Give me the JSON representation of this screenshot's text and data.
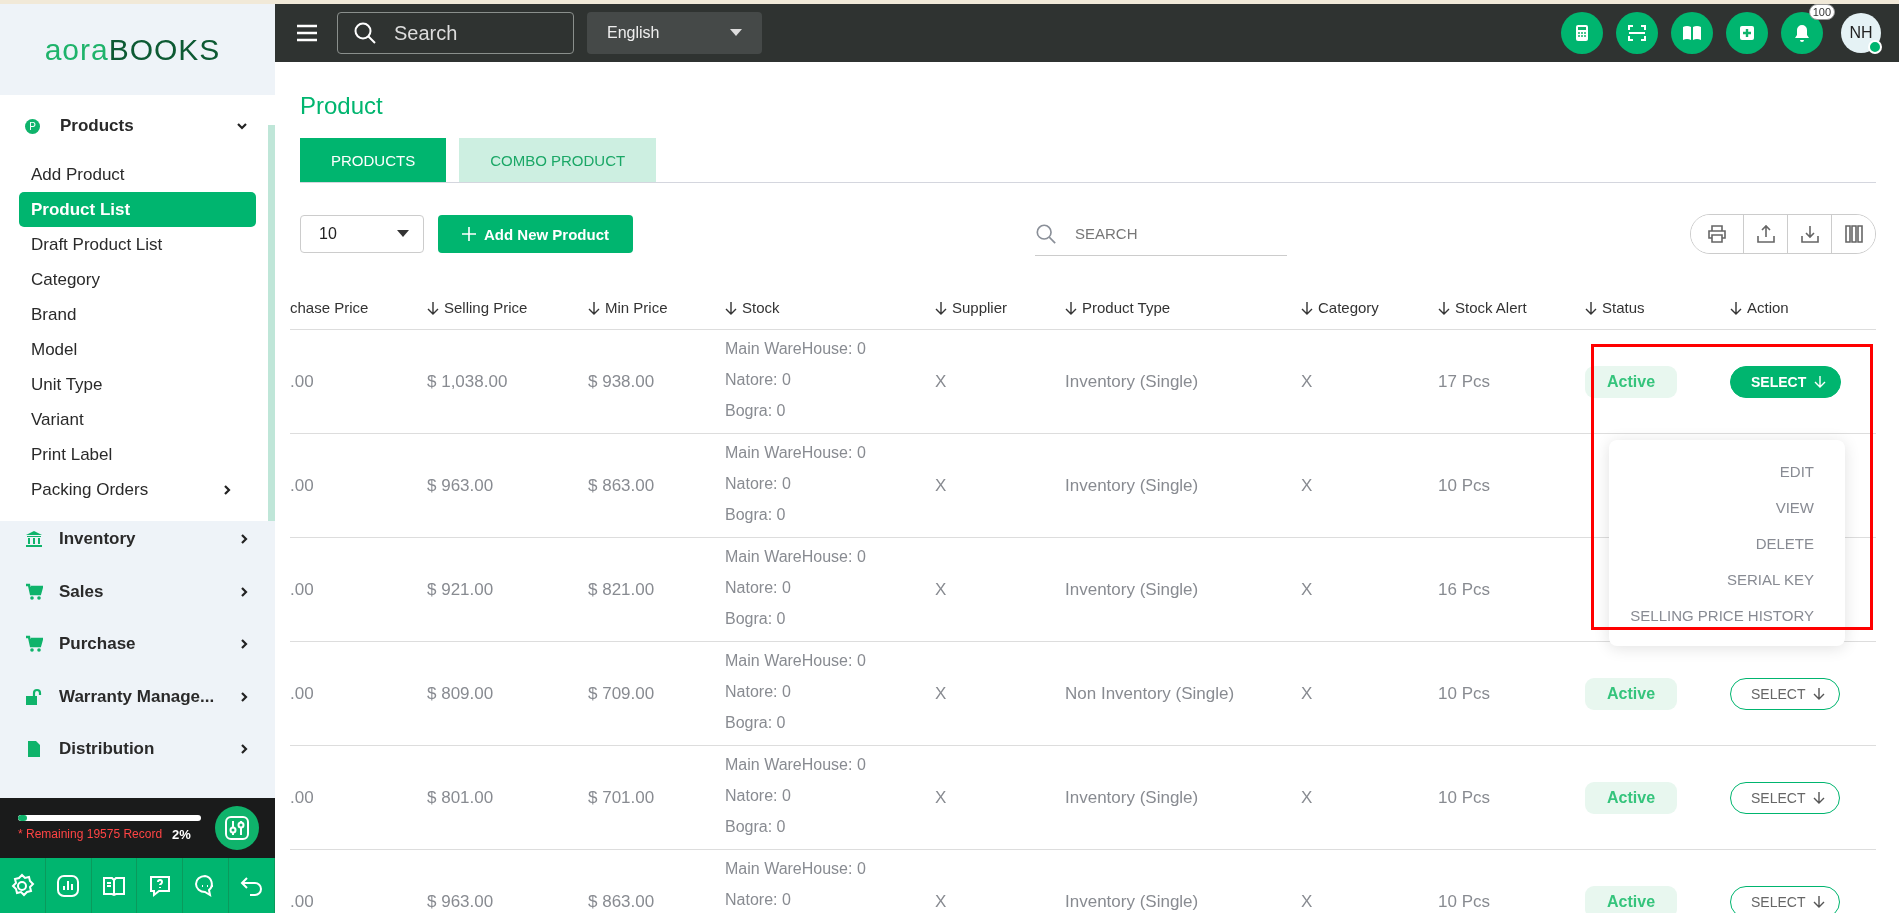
{
  "logo": {
    "light": "aora",
    "bold": "BOOKS"
  },
  "sidebar": {
    "section": {
      "badge": "P",
      "label": "Products",
      "expanded": true
    },
    "items": [
      {
        "label": "Add Product",
        "selected": false,
        "has_submenu": false
      },
      {
        "label": "Product List",
        "selected": true,
        "has_submenu": false
      },
      {
        "label": "Draft Product List",
        "selected": false,
        "has_submenu": false
      },
      {
        "label": "Category",
        "selected": false,
        "has_submenu": false
      },
      {
        "label": "Brand",
        "selected": false,
        "has_submenu": false
      },
      {
        "label": "Model",
        "selected": false,
        "has_submenu": false
      },
      {
        "label": "Unit Type",
        "selected": false,
        "has_submenu": false
      },
      {
        "label": "Variant",
        "selected": false,
        "has_submenu": false
      },
      {
        "label": "Print Label",
        "selected": false,
        "has_submenu": false
      },
      {
        "label": "Packing Orders",
        "selected": false,
        "has_submenu": true
      }
    ],
    "sections": [
      {
        "label": "Inventory"
      },
      {
        "label": "Sales"
      },
      {
        "label": "Purchase"
      },
      {
        "label": "Warranty Manage..."
      },
      {
        "label": "Distribution"
      }
    ]
  },
  "record_panel": {
    "level": 0.02,
    "text": "* Remaining 19575 Record",
    "percent": "2%"
  },
  "topbar": {
    "search_placeholder": "Search",
    "language": "English",
    "notification_count": "100",
    "avatar": "NH",
    "online": true
  },
  "page_title": "Product",
  "tabs": [
    {
      "label": "PRODUCTS",
      "selected": true
    },
    {
      "label": "COMBO PRODUCT",
      "selected": false
    }
  ],
  "toolbar": {
    "page_size": "10",
    "add_button": "Add New Product",
    "search_placeholder": "SEARCH"
  },
  "table": {
    "columns": [
      {
        "label": "chase Price",
        "sortable": false
      },
      {
        "label": "Selling Price",
        "sortable": true
      },
      {
        "label": "Min Price",
        "sortable": true
      },
      {
        "label": "Stock",
        "sortable": true
      },
      {
        "label": "Supplier",
        "sortable": true
      },
      {
        "label": "Product Type",
        "sortable": true
      },
      {
        "label": "Category",
        "sortable": true
      },
      {
        "label": "Stock Alert",
        "sortable": true
      },
      {
        "label": "Status",
        "sortable": true
      },
      {
        "label": "Action",
        "sortable": true
      }
    ],
    "rows": [
      {
        "purchase": ".00",
        "selling": "$ 1,038.00",
        "min": "$ 938.00",
        "stock": [
          "Main WareHouse: 0",
          "Natore: 0",
          "Bogra: 0"
        ],
        "supplier": "X",
        "type": "Inventory (Single)",
        "category": "X",
        "alert": "17 Pcs",
        "status": "Active",
        "action": "SELECT",
        "open": true
      },
      {
        "purchase": ".00",
        "selling": "$ 963.00",
        "min": "$ 863.00",
        "stock": [
          "Main WareHouse: 0",
          "Natore: 0",
          "Bogra: 0"
        ],
        "supplier": "X",
        "type": "Inventory (Single)",
        "category": "X",
        "alert": "10 Pcs"
      },
      {
        "purchase": ".00",
        "selling": "$ 921.00",
        "min": "$ 821.00",
        "stock": [
          "Main WareHouse: 0",
          "Natore: 0",
          "Bogra: 0"
        ],
        "supplier": "X",
        "type": "Inventory (Single)",
        "category": "X",
        "alert": "16 Pcs"
      },
      {
        "purchase": ".00",
        "selling": "$ 809.00",
        "min": "$ 709.00",
        "stock": [
          "Main WareHouse: 0",
          "Natore: 0",
          "Bogra: 0"
        ],
        "supplier": "X",
        "type": "Non Inventory (Single)",
        "category": "X",
        "alert": "10 Pcs",
        "status": "Active",
        "action": "SELECT",
        "open": false
      },
      {
        "purchase": ".00",
        "selling": "$ 801.00",
        "min": "$ 701.00",
        "stock": [
          "Main WareHouse: 0",
          "Natore: 0",
          "Bogra: 0"
        ],
        "supplier": "X",
        "type": "Inventory (Single)",
        "category": "X",
        "alert": "10 Pcs",
        "status": "Active",
        "action": "SELECT",
        "open": false
      },
      {
        "purchase": ".00",
        "selling": "$ 963.00",
        "min": "$ 863.00",
        "stock": [
          "Main WareHouse: 0",
          "Natore: 0"
        ],
        "supplier": "X",
        "type": "Inventory (Single)",
        "category": "X",
        "alert": "10 Pcs",
        "status": "Active",
        "action": "SELECT",
        "open": false
      }
    ]
  },
  "action_menu": {
    "highlighted": true,
    "items": [
      "EDIT",
      "VIEW",
      "DELETE",
      "SERIAL KEY",
      "SELLING PRICE HISTORY"
    ]
  }
}
